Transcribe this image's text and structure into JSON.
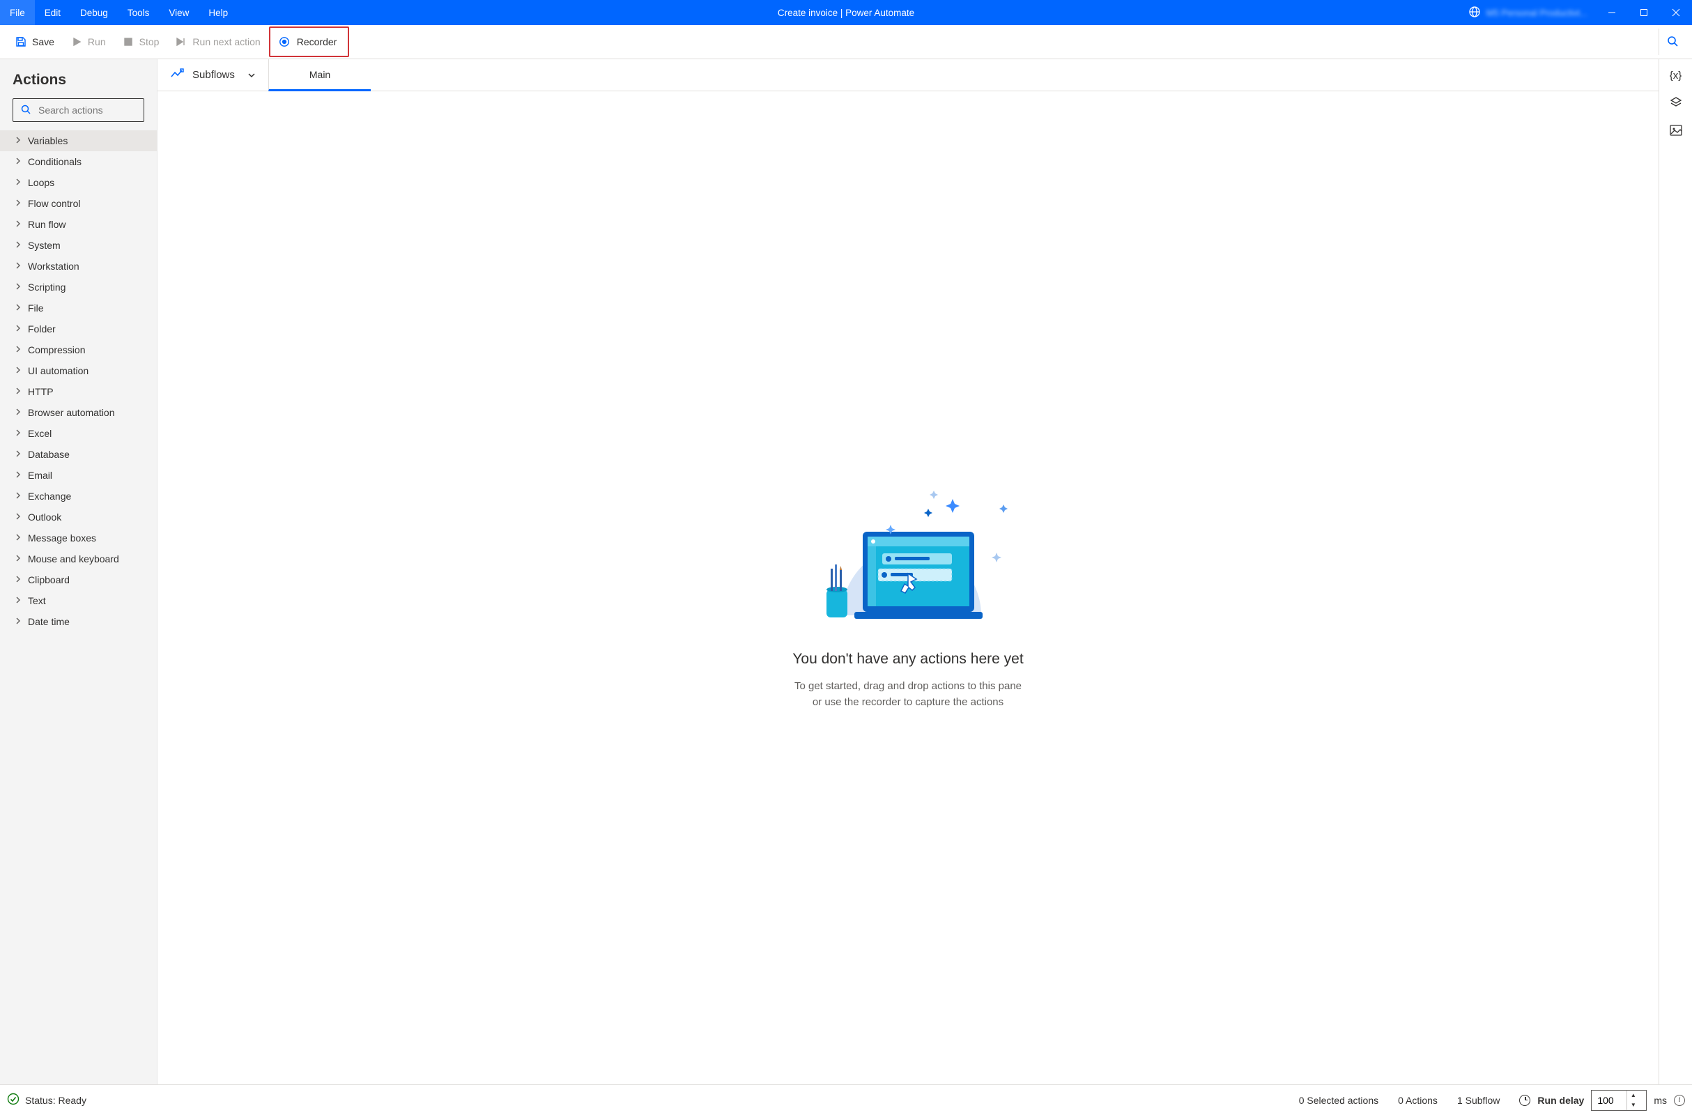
{
  "title": "Create invoice | Power Automate",
  "menu": [
    "File",
    "Edit",
    "Debug",
    "Tools",
    "View",
    "Help"
  ],
  "account_label": "M5 Personal Productivt...",
  "toolbar": {
    "save": "Save",
    "run": "Run",
    "stop": "Stop",
    "run_next": "Run next action",
    "recorder": "Recorder"
  },
  "sidebar": {
    "heading": "Actions",
    "search_placeholder": "Search actions",
    "categories": [
      "Variables",
      "Conditionals",
      "Loops",
      "Flow control",
      "Run flow",
      "System",
      "Workstation",
      "Scripting",
      "File",
      "Folder",
      "Compression",
      "UI automation",
      "HTTP",
      "Browser automation",
      "Excel",
      "Database",
      "Email",
      "Exchange",
      "Outlook",
      "Message boxes",
      "Mouse and keyboard",
      "Clipboard",
      "Text",
      "Date time"
    ]
  },
  "subflow": {
    "label": "Subflows",
    "main_tab": "Main"
  },
  "empty": {
    "title": "You don't have any actions here yet",
    "line1": "To get started, drag and drop actions to this pane",
    "line2": "or use the recorder to capture the actions"
  },
  "status": {
    "ready": "Status: Ready",
    "selected": "0 Selected actions",
    "actions": "0 Actions",
    "subflows": "1 Subflow",
    "run_delay_label": "Run delay",
    "run_delay_value": "100",
    "run_delay_unit": "ms"
  }
}
